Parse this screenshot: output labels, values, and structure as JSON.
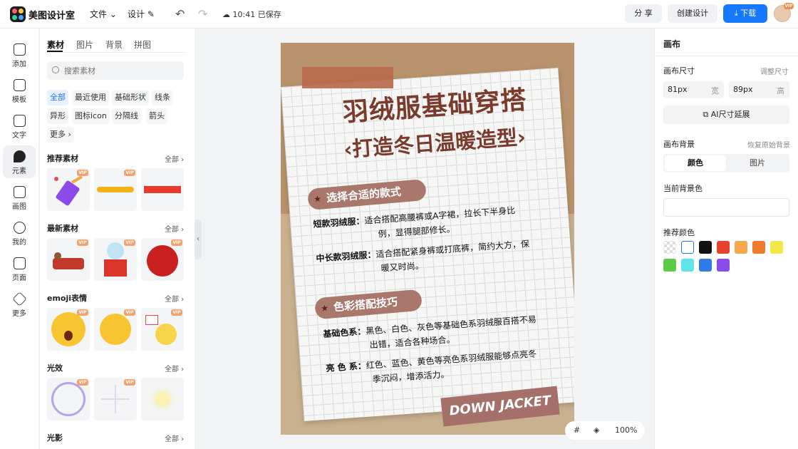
{
  "app": {
    "title": "美图设计室"
  },
  "menu": {
    "file": "文件",
    "design": "设计"
  },
  "save_status": "10:41 已保存",
  "actions": {
    "share": "分 享",
    "create_design": "创建设计",
    "download": "下载"
  },
  "avatar": {
    "badge": "VIP"
  },
  "rail": [
    {
      "label": "添加"
    },
    {
      "label": "模板"
    },
    {
      "label": "文字"
    },
    {
      "label": "元素"
    },
    {
      "label": "画图"
    },
    {
      "label": "我的"
    },
    {
      "label": "页面"
    },
    {
      "label": "更多"
    }
  ],
  "panel": {
    "tabs": [
      "素材",
      "图片",
      "背景",
      "拼图"
    ],
    "search_placeholder": "搜索素材",
    "chips": [
      "全部",
      "最近使用",
      "基础形状",
      "线条",
      "异形",
      "图标icon",
      "分隔线",
      "箭头",
      "更多"
    ],
    "all_label": "全部",
    "vip": "VIP",
    "sections": [
      "推荐素材",
      "最新素材",
      "emoji表情",
      "光效",
      "光影"
    ]
  },
  "poster": {
    "title": "羽绒服基础穿搭",
    "subtitle": "‹打造冬日温暖造型›",
    "pill1": "选择合适的款式",
    "item1_key": "短款羽绒服：",
    "item1_line1": "适合搭配高腰裤或A字裙，拉长下半身比",
    "item1_line2": "例，显得腿部修长。",
    "item2_key": "中长款羽绒服：",
    "item2_line1": "适合搭配紧身裤或打底裤，简约大方，保",
    "item2_line2": "暖又时尚。",
    "pill2": "色彩搭配技巧",
    "item3_key": "基础色系：",
    "item3_line1": "黑色、白色、灰色等基础色系羽绒服百搭不易",
    "item3_line2": "出错，适合各种场合。",
    "item4_key": "亮 色 系：",
    "item4_line1": "红色、蓝色、黄色等亮色系羽绒服能够点亮冬",
    "item4_line2": "季沉闷，增添活力。",
    "stamp": "DOWN JACKET"
  },
  "zoom": "100%",
  "right": {
    "title": "画布",
    "size_label": "画布尺寸",
    "adjust_size": "调整尺寸",
    "width_value": "81px",
    "width_unit": "宽",
    "height_value": "89px",
    "height_unit": "高",
    "ai_extend": "AI尺寸延展",
    "bg_label": "画布背景",
    "restore_bg": "恢复原始背景",
    "seg_color": "颜色",
    "seg_image": "图片",
    "current_bg": "当前背景色",
    "recommend": "推荐颜色",
    "swatches": [
      "transparent",
      "#ffffff",
      "#111111",
      "#e8412c",
      "#f5a94b",
      "#f07b2c",
      "#f3e84a",
      "#59cc45",
      "#5fe6e6",
      "#2f7be9",
      "#8a4bea"
    ]
  }
}
